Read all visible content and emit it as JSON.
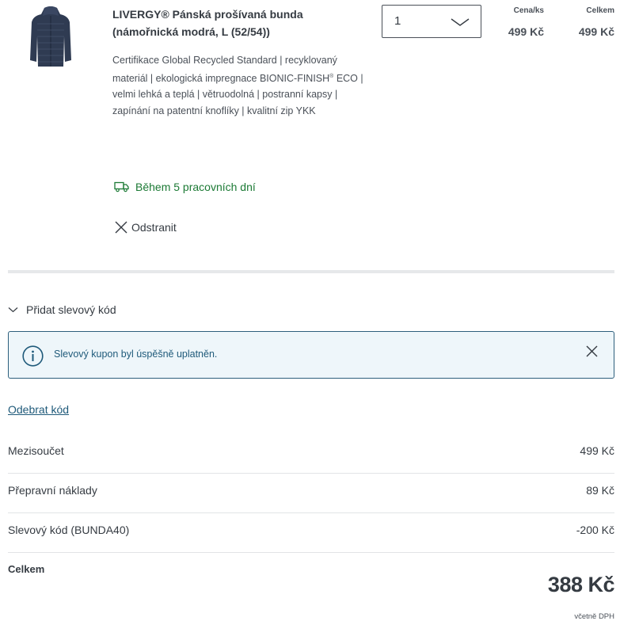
{
  "product": {
    "image_icon": "jacket-image",
    "title": "LIVERGY® Pánská prošívaná bunda (námořnická modrá, L (52/54))",
    "description_main": "Certifikace Global Recycled Standard | recyklovaný materiál | ekologická impregnace BIONIC-FINISH",
    "description_sup": "®",
    "description_rest": " ECO | velmi lehká a teplá | větruodolná | postranní kapsy | zapínání na patentní knoflíky | kvalitní zip YKK",
    "quantity": "1",
    "unit_price_header": "Cena/ks",
    "unit_price": "499 Kč",
    "total_header": "Celkem",
    "total_price": "499 Kč",
    "delivery_icon": "truck-icon",
    "delivery_text": "Během 5 pracovních dní",
    "remove_label": "Odstranit"
  },
  "coupon": {
    "toggle_label": "Přidat slevový kód",
    "info_message": "Slevový kupon byl úspěšně uplatněn.",
    "remove_code_label": "Odebrat kód"
  },
  "summary": {
    "rows": [
      {
        "label": "Mezisoučet",
        "value": "499 Kč"
      },
      {
        "label": "Přepravní náklady",
        "value": "89 Kč"
      },
      {
        "label": "Slevový kód (BUNDA40)",
        "value": "-200 Kč"
      }
    ],
    "total_label": "Celkem",
    "total_value": "388 Kč",
    "vat_note": "včetně DPH"
  },
  "colors": {
    "delivery_green": "#1c7a35",
    "info_blue": "#1f5a7a",
    "info_bg": "#eef6fa",
    "text_dark": "#353b42"
  }
}
